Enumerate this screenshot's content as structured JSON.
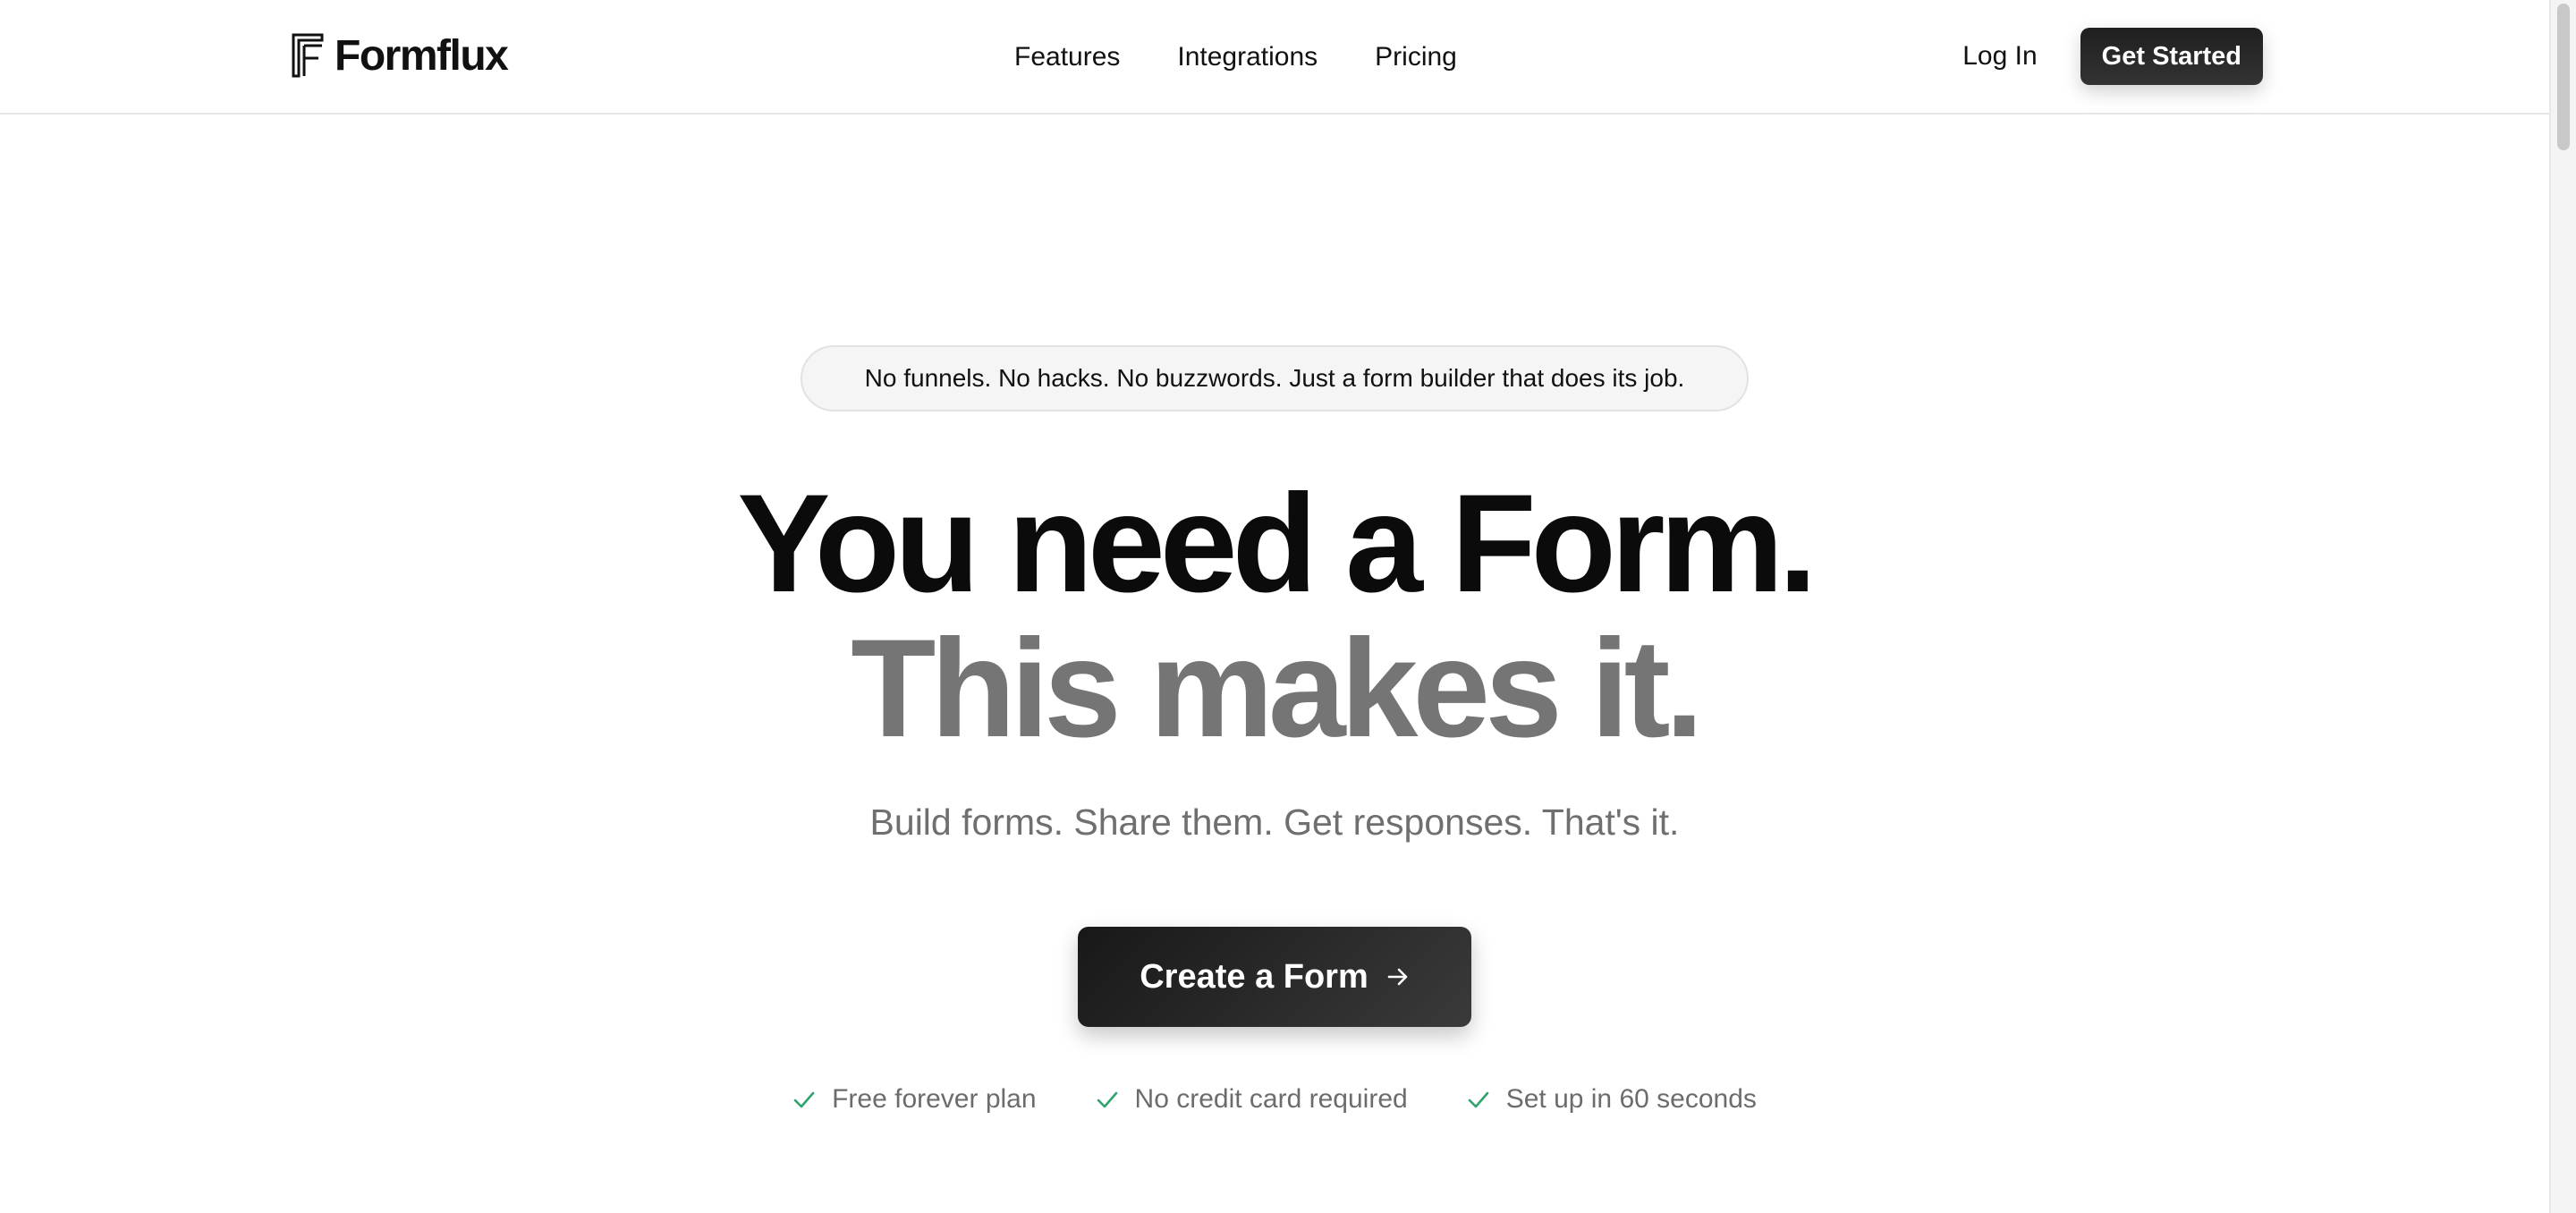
{
  "brand": {
    "name": "Formflux",
    "logo_icon": "formflux-logo-icon"
  },
  "nav": {
    "links": [
      {
        "label": "Features"
      },
      {
        "label": "Integrations"
      },
      {
        "label": "Pricing"
      }
    ],
    "login_label": "Log In",
    "get_started_label": "Get Started"
  },
  "hero": {
    "pill_text": "No funnels. No hacks. No buzzwords. Just a form builder that does its job.",
    "headline_line1": "You need a Form.",
    "headline_line2": "This makes it.",
    "subheadline": "Build forms. Share them. Get responses. That's it.",
    "cta_label": "Create a Form",
    "cta_icon": "arrow-right-icon",
    "features": [
      {
        "label": "Free forever plan",
        "icon": "check-icon"
      },
      {
        "label": "No credit card required",
        "icon": "check-icon"
      },
      {
        "label": "Set up in 60 seconds",
        "icon": "check-icon"
      }
    ]
  },
  "colors": {
    "text_primary": "#111111",
    "headline_secondary": "#757575",
    "muted": "#6f6f6f",
    "check_green": "#2fa36b",
    "button_dark": "#1f1f1f"
  }
}
